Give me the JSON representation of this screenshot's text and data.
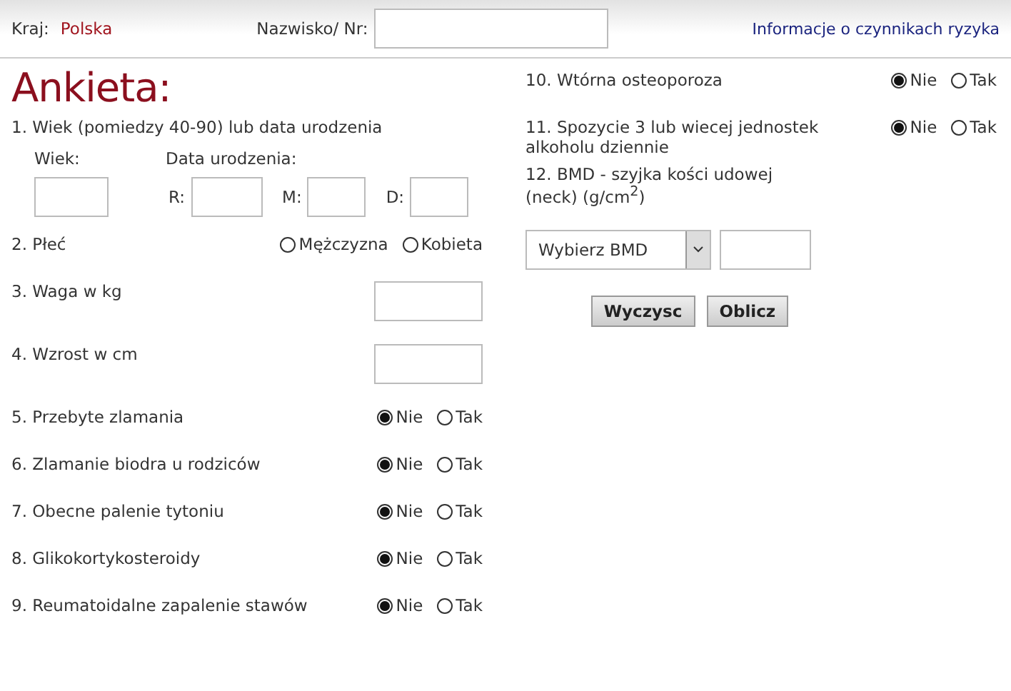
{
  "header": {
    "country_label": "Kraj:",
    "country": "Polska",
    "name_label": "Nazwisko/ Nr:",
    "link": "Informacje o czynnikach ryzyka"
  },
  "title": "Ankieta:",
  "left_questions": [
    {
      "kind": "age",
      "label": "1. Wiek (pomiedzy 40-90) lub data urodzenia",
      "age_label": "Wiek:",
      "date_label": "Data urodzenia:",
      "date_fields": [
        "R:",
        "M:",
        "D:"
      ]
    },
    {
      "kind": "radio",
      "label": "2. Płeć",
      "options": [
        {
          "label": "Mężczyzna",
          "selected": false
        },
        {
          "label": "Kobieta",
          "selected": false
        }
      ]
    },
    {
      "kind": "input",
      "label": "3. Waga w kg"
    },
    {
      "kind": "input",
      "label": "4. Wzrost w cm"
    },
    {
      "kind": "radio",
      "label": "5. Przebyte zlamania",
      "options": [
        {
          "label": "Nie",
          "selected": true
        },
        {
          "label": "Tak",
          "selected": false
        }
      ]
    },
    {
      "kind": "radio",
      "label": "6. Zlamanie biodra u rodziców",
      "options": [
        {
          "label": "Nie",
          "selected": true
        },
        {
          "label": "Tak",
          "selected": false
        }
      ]
    },
    {
      "kind": "radio",
      "label": "7. Obecne palenie tytoniu",
      "options": [
        {
          "label": "Nie",
          "selected": true
        },
        {
          "label": "Tak",
          "selected": false
        }
      ]
    },
    {
      "kind": "radio",
      "label": "8. Glikokortykosteroidy",
      "options": [
        {
          "label": "Nie",
          "selected": true
        },
        {
          "label": "Tak",
          "selected": false
        }
      ]
    },
    {
      "kind": "radio",
      "label": "9. Reumatoidalne zapalenie stawów",
      "options": [
        {
          "label": "Nie",
          "selected": true
        },
        {
          "label": "Tak",
          "selected": false
        }
      ]
    }
  ],
  "right_questions": [
    {
      "kind": "radio",
      "label": "10. Wtórna osteoporoza",
      "options": [
        {
          "label": "Nie",
          "selected": true
        },
        {
          "label": "Tak",
          "selected": false
        }
      ]
    },
    {
      "kind": "radio",
      "label": "11. Spozycie 3 lub wiecej jednostek alkoholu dziennie",
      "options": [
        {
          "label": "Nie",
          "selected": true
        },
        {
          "label": "Tak",
          "selected": false
        }
      ]
    },
    {
      "kind": "bmd",
      "label": "12. BMD - szyjka kości udowej (neck) (g/cm$^{2}$)",
      "select": "Wybierz BMD"
    }
  ],
  "buttons": [
    "Wyczysc",
    "Oblicz"
  ]
}
